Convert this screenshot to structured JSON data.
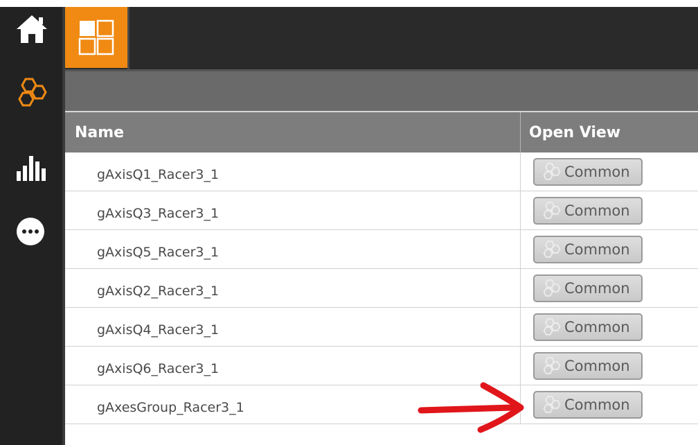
{
  "sidebar": {
    "items": [
      {
        "icon": "home-icon"
      },
      {
        "icon": "hexagon-cluster-icon",
        "color": "#f08a13"
      },
      {
        "icon": "bar-chart-icon"
      },
      {
        "icon": "more-icon"
      }
    ]
  },
  "topbar": {
    "tile_icon": "tile-grid-icon",
    "accent": "#f08a13"
  },
  "table": {
    "headers": {
      "name": "Name",
      "open_view": "Open View"
    },
    "rows": [
      {
        "name": "gAxisQ1_Racer3_1",
        "button": "Common"
      },
      {
        "name": "gAxisQ3_Racer3_1",
        "button": "Common"
      },
      {
        "name": "gAxisQ5_Racer3_1",
        "button": "Common"
      },
      {
        "name": "gAxisQ2_Racer3_1",
        "button": "Common"
      },
      {
        "name": "gAxisQ4_Racer3_1",
        "button": "Common"
      },
      {
        "name": "gAxisQ6_Racer3_1",
        "button": "Common"
      },
      {
        "name": "gAxesGroup_Racer3_1",
        "button": "Common"
      }
    ]
  },
  "annotation": {
    "arrow_color": "#e0161b"
  }
}
